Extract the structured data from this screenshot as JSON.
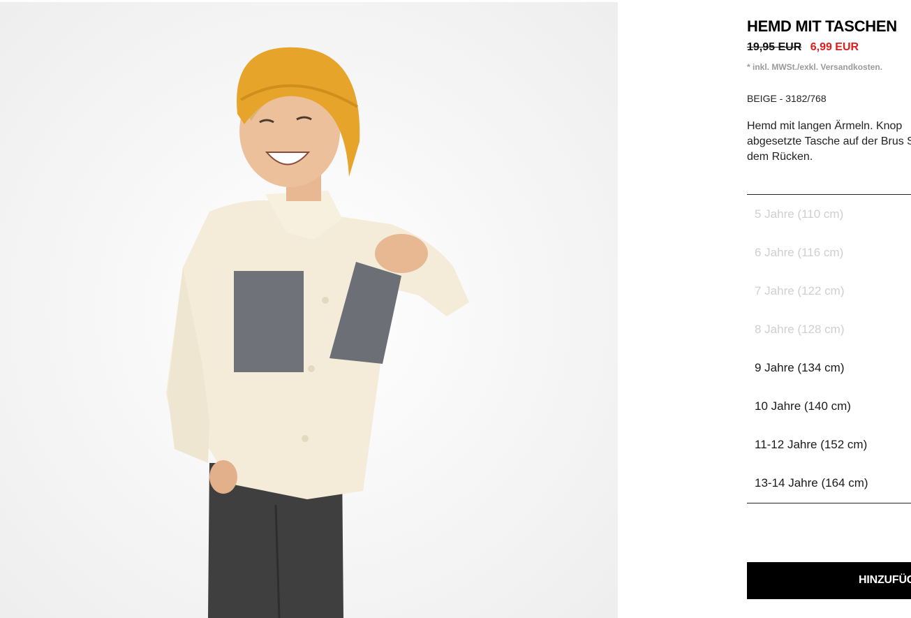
{
  "product": {
    "title": "HEMD MIT TASCHEN",
    "old_price": "19,95 EUR",
    "new_price": "6,99 EUR",
    "tax_note": "* inkl. MWSt./exkl. Versandkosten.",
    "color_ref": "BEIGE - 3182/768",
    "description": "Hemd mit langen Ärmeln. Knop abgesetzte Tasche auf der Brus Saum auf dem Rücken."
  },
  "sizes": [
    {
      "label": "5 Jahre (110 cm)",
      "available": false
    },
    {
      "label": "6 Jahre (116 cm)",
      "available": false
    },
    {
      "label": "7 Jahre (122 cm)",
      "available": false
    },
    {
      "label": "8 Jahre (128 cm)",
      "available": false
    },
    {
      "label": "9 Jahre (134 cm)",
      "available": true
    },
    {
      "label": "10 Jahre (140 cm)",
      "available": true
    },
    {
      "label": "11-12 Jahre (152 cm)",
      "available": true
    },
    {
      "label": "13-14 Jahre (164 cm)",
      "available": true
    }
  ],
  "actions": {
    "add_label": "HINZUFÜG"
  },
  "colors": {
    "sale_red": "#e01b1b",
    "button_bg": "#000000",
    "unavailable_text": "#cfcfcf"
  }
}
